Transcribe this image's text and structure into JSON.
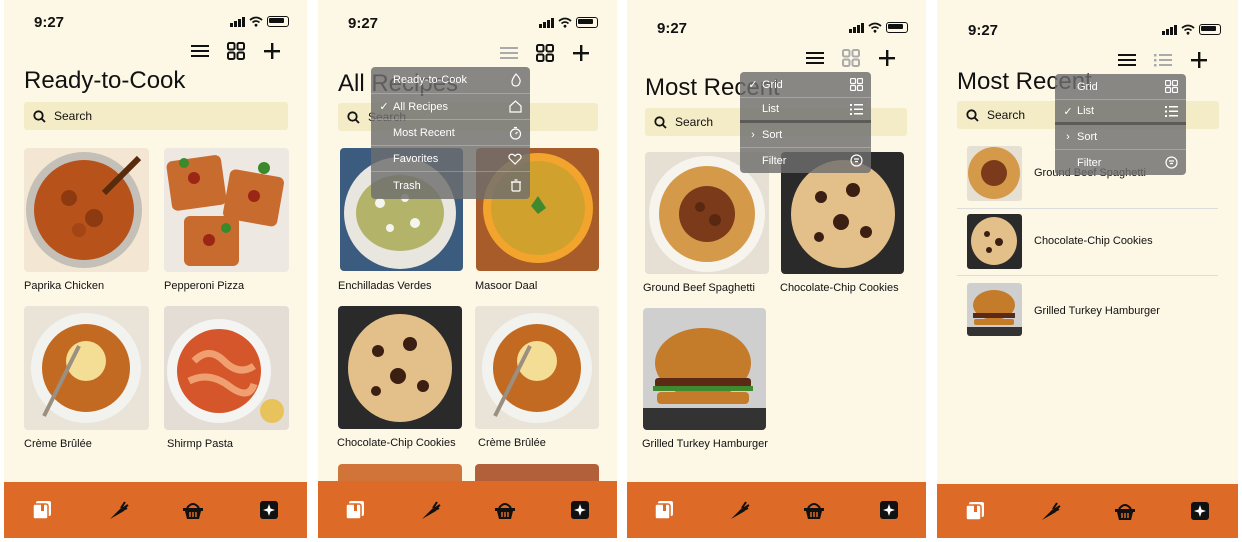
{
  "status": {
    "time": "9:27"
  },
  "search": {
    "placeholder": "Search"
  },
  "screen1": {
    "title": "Ready-to-Cook",
    "recipes": [
      "Paprika Chicken",
      "Pepperoni Pizza",
      "Crème Brûlée",
      "Shirmp Pasta"
    ]
  },
  "screen2": {
    "title": "All Recipes",
    "recipes": [
      "Enchilladas Verdes",
      "Masoor Daal",
      "Chocolate-Chip Cookies",
      "Crème Brûlée"
    ],
    "menu": [
      {
        "label": "Ready-to-Cook",
        "icon": "flame-icon",
        "checked": false
      },
      {
        "label": "All Recipes",
        "icon": "home-icon",
        "checked": true
      },
      {
        "label": "Most Recent",
        "icon": "timer-icon",
        "checked": false
      },
      {
        "label": "Favorites",
        "icon": "heart-icon",
        "checked": false
      },
      {
        "label": "Trash",
        "icon": "trash-icon",
        "checked": false
      }
    ]
  },
  "screen3": {
    "title": "Most Recent",
    "recipes": [
      "Ground Beef Spaghetti",
      "Chocolate-Chip Cookies",
      "Grilled Turkey Hamburger"
    ],
    "menu": [
      {
        "label": "Grid",
        "icon": "grid-icon",
        "prefix": "✓"
      },
      {
        "label": "List",
        "icon": "list-icon",
        "prefix": ""
      },
      {
        "label": "Sort",
        "icon": "",
        "prefix": "›"
      },
      {
        "label": "Filter",
        "icon": "filter-icon",
        "prefix": ""
      }
    ]
  },
  "screen4": {
    "title": "Most Recent",
    "recipes": [
      "Ground Beef Spaghetti",
      "Chocolate-Chip Cookies",
      "Grilled Turkey Hamburger"
    ],
    "menu": [
      {
        "label": "Grid",
        "icon": "grid-icon",
        "prefix": ""
      },
      {
        "label": "List",
        "icon": "list-icon",
        "prefix": "✓"
      },
      {
        "label": "Sort",
        "icon": "",
        "prefix": "›"
      },
      {
        "label": "Filter",
        "icon": "filter-icon",
        "prefix": ""
      }
    ]
  },
  "nav": {
    "items": [
      "recipe-book-icon",
      "carrot-icon",
      "basket-icon",
      "sparkle-icon"
    ]
  },
  "colors": {
    "background": "#fdf8e6",
    "search_bg": "#f4ebc7",
    "nav_bg": "#dd6a26",
    "menu_bg": "#6e6e6e"
  }
}
